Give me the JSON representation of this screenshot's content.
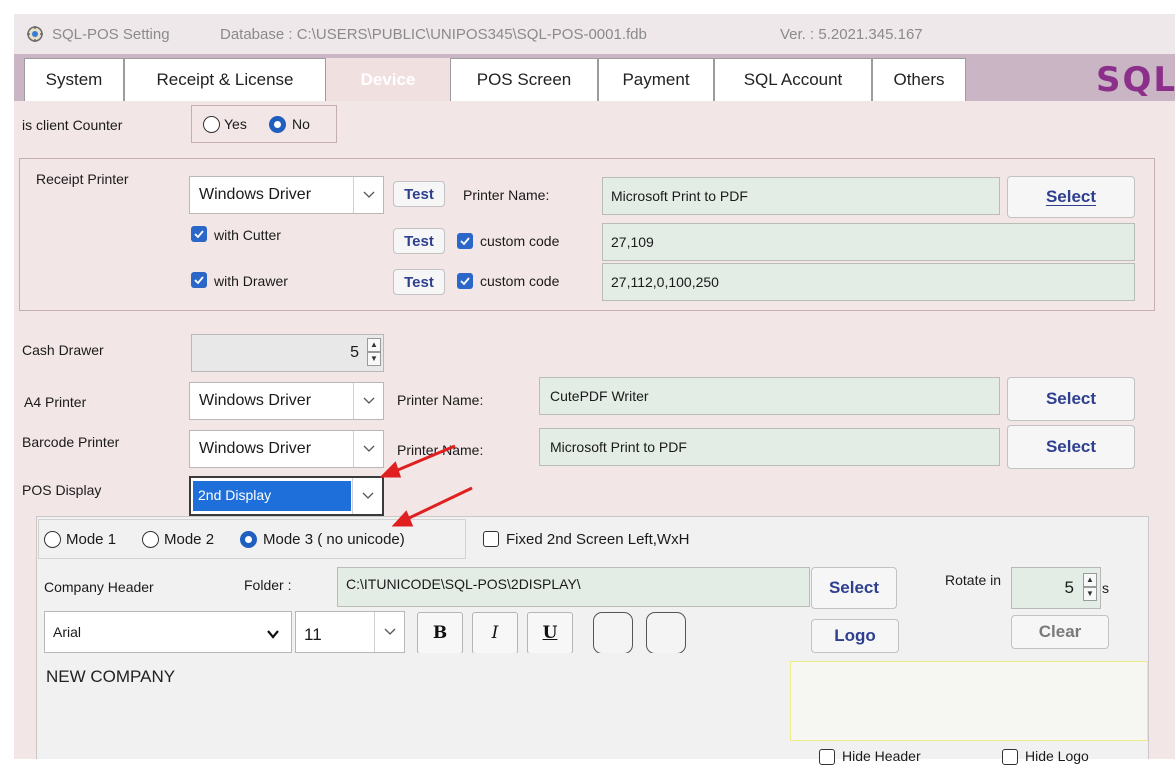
{
  "title": {
    "app": "SQL-POS Setting",
    "database": "Database : C:\\USERS\\PUBLIC\\UNIPOS345\\SQL-POS-0001.fdb",
    "version": "Ver. : 5.2021.345.167"
  },
  "tabs": [
    "System",
    "Receipt & License",
    "Device",
    "POS Screen",
    "Payment",
    "SQL Account",
    "Others"
  ],
  "brand": "SQL",
  "client_counter": {
    "label": "is client Counter",
    "yes": "Yes",
    "no": "No",
    "selected": "No"
  },
  "receipt_printer": {
    "label": "Receipt Printer",
    "driver": "Windows Driver",
    "test": "Test",
    "printer_name_label": "Printer Name:",
    "printer_name": "Microsoft Print to PDF",
    "select": "Select",
    "cutter_label": "with Cutter",
    "drawer_label": "with Drawer",
    "custom_code_label": "custom code",
    "cutter_code": "27,109",
    "drawer_code": "27,112,0,100,250"
  },
  "cash_drawer": {
    "label": "Cash Drawer",
    "value": "5"
  },
  "a4_printer": {
    "label": "A4 Printer",
    "driver": "Windows Driver",
    "printer_name_label": "Printer Name:",
    "printer_name": "CutePDF Writer",
    "select": "Select"
  },
  "barcode_printer": {
    "label": "Barcode Printer",
    "driver": "Windows Driver",
    "printer_name_label": "Printer Name:",
    "printer_name": "Microsoft Print to PDF",
    "select": "Select"
  },
  "pos_display": {
    "label": "POS Display",
    "value": "2nd Display"
  },
  "display_panel": {
    "mode1": "Mode 1",
    "mode2": "Mode 2",
    "mode3": "Mode 3 ( no unicode)",
    "selected_mode": "Mode 3 ( no unicode)",
    "fixed_label": "Fixed 2nd Screen Left,WxH",
    "company_header_label": "Company Header",
    "folder_label": "Folder :",
    "folder_path": "C:\\ITUNICODE\\SQL-POS\\2DISPLAY\\",
    "select": "Select",
    "rotate_label": "Rotate in",
    "rotate_value": "5",
    "rotate_unit": "s",
    "font": "Arial",
    "font_size": "11",
    "bold": "B",
    "italic": "I",
    "underline": "U",
    "logo": "Logo",
    "clear": "Clear",
    "header_text": "NEW COMPANY",
    "hide_header": "Hide Header",
    "hide_logo": "Hide Logo"
  },
  "colors": {
    "background": "#f3e6e6",
    "tabbar": "#c9b5c3",
    "field": "#e3ede5",
    "selection": "#1e6fd9",
    "accent_button_text": "#2e3f8f",
    "annotation_arrow": "#e02020"
  }
}
